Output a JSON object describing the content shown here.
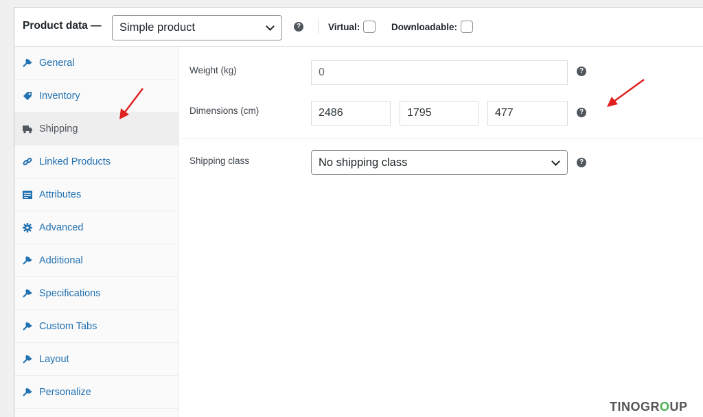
{
  "header": {
    "title": "Product data —",
    "product_type": "Simple product",
    "virtual_label": "Virtual:",
    "downloadable_label": "Downloadable:"
  },
  "sidebar": {
    "items": [
      {
        "label": "General",
        "icon": "wrench-icon"
      },
      {
        "label": "Inventory",
        "icon": "tag-icon"
      },
      {
        "label": "Shipping",
        "icon": "truck-icon",
        "active": true
      },
      {
        "label": "Linked Products",
        "icon": "link-icon"
      },
      {
        "label": "Attributes",
        "icon": "list-icon"
      },
      {
        "label": "Advanced",
        "icon": "gear-icon"
      },
      {
        "label": "Additional",
        "icon": "wrench-icon"
      },
      {
        "label": "Specifications",
        "icon": "wrench-icon"
      },
      {
        "label": "Custom Tabs",
        "icon": "wrench-icon"
      },
      {
        "label": "Layout",
        "icon": "wrench-icon"
      },
      {
        "label": "Personalize",
        "icon": "wrench-icon"
      }
    ]
  },
  "shipping": {
    "weight_label": "Weight (kg)",
    "weight_value": "0",
    "dimensions_label": "Dimensions (cm)",
    "length": "2486",
    "width": "1795",
    "height": "477",
    "class_label": "Shipping class",
    "class_value": "No shipping class"
  },
  "watermark": {
    "part1": "TINO",
    "part2": "GR",
    "part3": "O",
    "part4": "UP"
  },
  "colors": {
    "link": "#2271b1",
    "arrow": "#e02020",
    "help": "#50575e"
  }
}
